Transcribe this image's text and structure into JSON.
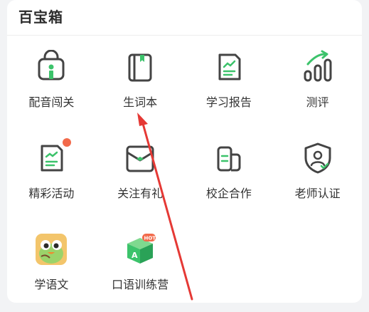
{
  "panel": {
    "title": "百宝箱"
  },
  "colors": {
    "icon_stroke": "#444444",
    "accent": "#3cc36b",
    "badge": "#f26a4b",
    "annotation_arrow": "#e53935"
  },
  "items": [
    {
      "label": "配音闯关",
      "icon": "dubbing-icon"
    },
    {
      "label": "生词本",
      "icon": "vocabulary-book-icon"
    },
    {
      "label": "学习报告",
      "icon": "report-icon"
    },
    {
      "label": "测评",
      "icon": "assessment-icon"
    },
    {
      "label": "精彩活动",
      "icon": "activity-icon",
      "badge": true
    },
    {
      "label": "关注有礼",
      "icon": "gift-envelope-icon"
    },
    {
      "label": "校企合作",
      "icon": "cooperation-icon"
    },
    {
      "label": "老师认证",
      "icon": "teacher-cert-icon"
    },
    {
      "label": "学语文",
      "icon": "chinese-learning-icon"
    },
    {
      "label": "口语训练营",
      "icon": "speaking-camp-icon",
      "badge_text": "HOT"
    }
  ]
}
